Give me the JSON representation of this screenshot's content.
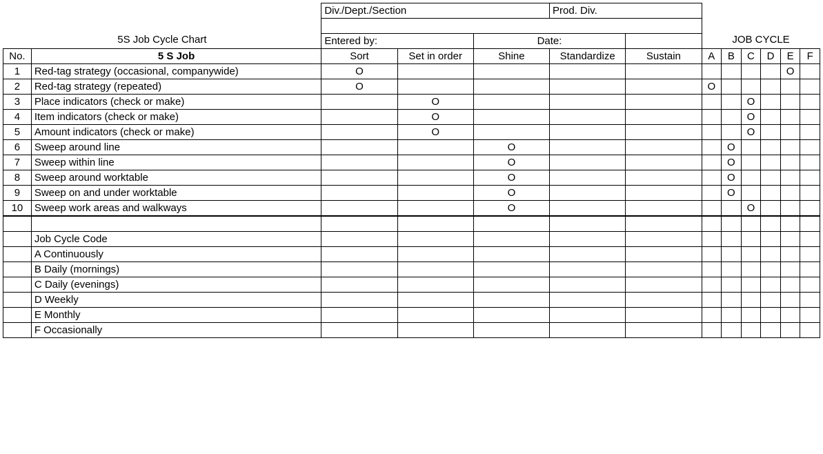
{
  "header": {
    "title": "5S Job Cycle Chart",
    "div_dept_section_label": "Div./Dept./Section",
    "prod_div_label": "Prod. Div.",
    "entered_by_label": "Entered by:",
    "date_label": "Date:",
    "job_cycle_label": "JOB CYCLE"
  },
  "columns": {
    "no": "No.",
    "job": "5 S Job",
    "sort": "Sort",
    "set_in_order": "Set in order",
    "shine": "Shine",
    "standardize": "Standardize",
    "sustain": "Sustain",
    "cycle": [
      "A",
      "B",
      "C",
      "D",
      "E",
      "F"
    ]
  },
  "mark": "O",
  "rows": [
    {
      "no": "1",
      "job": "Red-tag strategy (occasional, companywide)",
      "sort": "O",
      "set": "",
      "shine": "",
      "std": "",
      "sus": "",
      "cycle": [
        "",
        "",
        "",
        "",
        "O",
        ""
      ]
    },
    {
      "no": "2",
      "job": "Red-tag strategy (repeated)",
      "sort": "O",
      "set": "",
      "shine": "",
      "std": "",
      "sus": "",
      "cycle": [
        "O",
        "",
        "",
        "",
        "",
        ""
      ]
    },
    {
      "no": "3",
      "job": "Place indicators (check or make)",
      "sort": "",
      "set": "O",
      "shine": "",
      "std": "",
      "sus": "",
      "cycle": [
        "",
        "",
        "O",
        "",
        "",
        ""
      ]
    },
    {
      "no": "4",
      "job": "Item indicators (check or make)",
      "sort": "",
      "set": "O",
      "shine": "",
      "std": "",
      "sus": "",
      "cycle": [
        "",
        "",
        "O",
        "",
        "",
        ""
      ]
    },
    {
      "no": "5",
      "job": "Amount indicators (check or make)",
      "sort": "",
      "set": "O",
      "shine": "",
      "std": "",
      "sus": "",
      "cycle": [
        "",
        "",
        "O",
        "",
        "",
        ""
      ]
    },
    {
      "no": "6",
      "job": "Sweep around line",
      "sort": "",
      "set": "",
      "shine": "O",
      "std": "",
      "sus": "",
      "cycle": [
        "",
        "O",
        "",
        "",
        "",
        ""
      ]
    },
    {
      "no": "7",
      "job": "Sweep within line",
      "sort": "",
      "set": "",
      "shine": "O",
      "std": "",
      "sus": "",
      "cycle": [
        "",
        "O",
        "",
        "",
        "",
        ""
      ]
    },
    {
      "no": "8",
      "job": "Sweep around worktable",
      "sort": "",
      "set": "",
      "shine": "O",
      "std": "",
      "sus": "",
      "cycle": [
        "",
        "O",
        "",
        "",
        "",
        ""
      ]
    },
    {
      "no": "9",
      "job": "Sweep on and under worktable",
      "sort": "",
      "set": "",
      "shine": "O",
      "std": "",
      "sus": "",
      "cycle": [
        "",
        "O",
        "",
        "",
        "",
        ""
      ]
    },
    {
      "no": "10",
      "job": "Sweep work areas and walkways",
      "sort": "",
      "set": "",
      "shine": "O",
      "std": "",
      "sus": "",
      "cycle": [
        "",
        "",
        "O",
        "",
        "",
        ""
      ]
    }
  ],
  "legend": {
    "title": "Job Cycle Code",
    "items": [
      "A Continuously",
      "B Daily (mornings)",
      "C Daily (evenings)",
      "D Weekly",
      "E Monthly",
      "F Occasionally"
    ]
  }
}
